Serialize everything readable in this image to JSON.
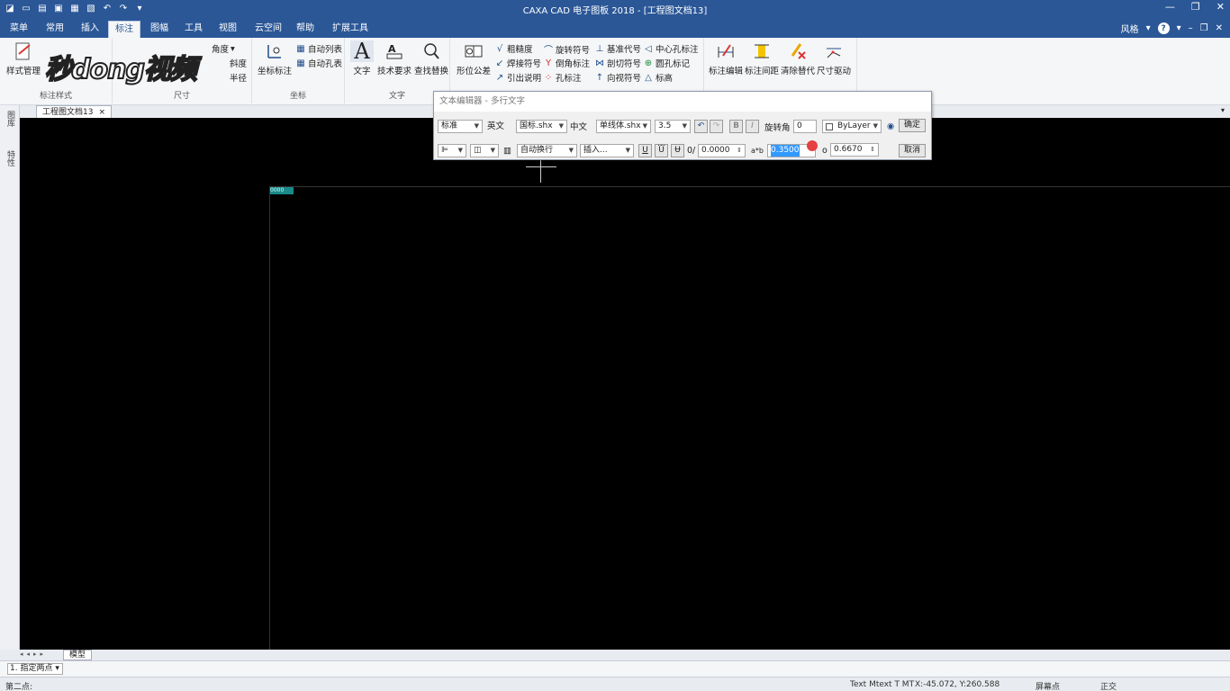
{
  "window": {
    "title": "CAXA CAD 电子图板 2018 - [工程图文档13]",
    "controls": [
      "—",
      "❐",
      "✕"
    ]
  },
  "menu": {
    "tabs": [
      "菜单",
      "常用",
      "插入",
      "标注",
      "图幅",
      "工具",
      "视图",
      "云空间",
      "帮助",
      "扩展工具"
    ],
    "active_tab": "标注",
    "style_label": "风格"
  },
  "ribbon": {
    "style_group": {
      "button": "样式管理",
      "title": "标注样式"
    },
    "dimension_group": {
      "items": [
        "角度",
        "斜度",
        "半径"
      ],
      "title": "尺寸"
    },
    "coord_group": {
      "button": "坐标标注",
      "small": [
        "自动列表",
        "自动孔表"
      ],
      "title": "坐标"
    },
    "text_group": {
      "buttons": [
        "文字",
        "技术要求",
        "查找替换"
      ],
      "title": "文字"
    },
    "symbol_group": {
      "big": "形位公差",
      "small": [
        "粗糙度",
        "焊接符号",
        "引出说明",
        "旋转符号",
        "倒角标注",
        "孔标注",
        "基准代号",
        "剖切符号",
        "向视符号",
        "中心孔标注",
        "圆孔标记",
        "标高"
      ]
    },
    "edit_group": {
      "buttons": [
        "标注编辑",
        "标注间距",
        "清除替代",
        "尺寸驱动"
      ]
    }
  },
  "watermark": "秒dong视频",
  "doc_tab": {
    "label": "工程图文档13",
    "close": "×"
  },
  "left_strip": [
    "图库",
    "特性"
  ],
  "canvas": {
    "highlight_text": "0000"
  },
  "text_editor": {
    "title": "文本编辑器 - 多行文字",
    "style": "标准",
    "english_label": "英文",
    "english_font": "国标.shx",
    "chinese_label": "中文",
    "chinese_font": "单线体.shx",
    "height": "3.5",
    "bold": "B",
    "italic": "I",
    "rotate_label": "旋转角",
    "rotate_value": "0",
    "color": "ByLayer",
    "ok": "确定",
    "wrap": "自动换行",
    "insert": "插入...",
    "underline": "U",
    "slant_label": "0/",
    "slant_value": "0.0000",
    "spacing_label": "a*b",
    "spacing_value": "0.3500",
    "ratio_label": "o",
    "ratio_value": "0.6670",
    "cancel": "取消"
  },
  "layout": {
    "nav": "◂◂▸▸",
    "model_tab": "模型"
  },
  "command": {
    "option": "1. 指定两点"
  },
  "status": {
    "prompt": "第二点:",
    "command_text": "Text Mtext T MT",
    "coords": "X:-45.072, Y:260.588",
    "snap": "屏幕点",
    "ortho": "正交"
  }
}
